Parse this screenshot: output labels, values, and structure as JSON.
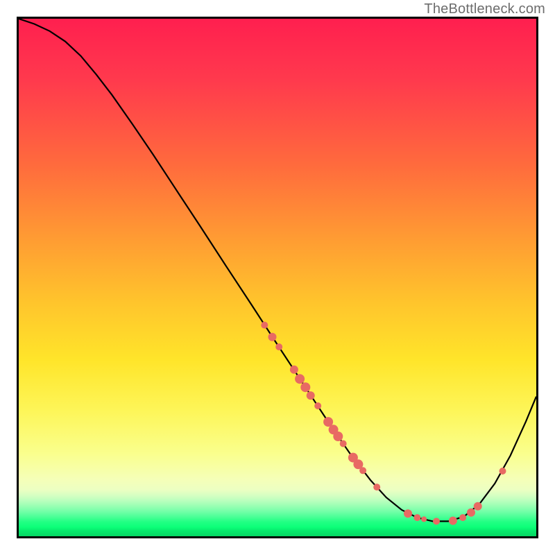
{
  "attribution": "TheBottleneck.com",
  "colors": {
    "curve": "#000000",
    "point": "#e86a63",
    "border": "#000000"
  },
  "chart_data": {
    "type": "line",
    "title": "",
    "xlabel": "",
    "ylabel": "",
    "xlim": [
      0,
      100
    ],
    "ylim": [
      0,
      100
    ],
    "curve": [
      {
        "x": 0,
        "y": 100
      },
      {
        "x": 3,
        "y": 99
      },
      {
        "x": 6,
        "y": 97.6
      },
      {
        "x": 9,
        "y": 95.6
      },
      {
        "x": 12,
        "y": 92.8
      },
      {
        "x": 15,
        "y": 89.2
      },
      {
        "x": 18,
        "y": 85.3
      },
      {
        "x": 22,
        "y": 79.6
      },
      {
        "x": 26,
        "y": 73.7
      },
      {
        "x": 30,
        "y": 67.6
      },
      {
        "x": 35,
        "y": 60.0
      },
      {
        "x": 40,
        "y": 52.3
      },
      {
        "x": 45,
        "y": 44.7
      },
      {
        "x": 50,
        "y": 37.0
      },
      {
        "x": 55,
        "y": 29.4
      },
      {
        "x": 60,
        "y": 21.8
      },
      {
        "x": 64,
        "y": 16.0
      },
      {
        "x": 68,
        "y": 10.8
      },
      {
        "x": 71,
        "y": 7.5
      },
      {
        "x": 74,
        "y": 5.1
      },
      {
        "x": 77,
        "y": 3.6
      },
      {
        "x": 80,
        "y": 2.9
      },
      {
        "x": 83,
        "y": 2.9
      },
      {
        "x": 86,
        "y": 3.8
      },
      {
        "x": 89,
        "y": 6.2
      },
      {
        "x": 92,
        "y": 10.2
      },
      {
        "x": 95,
        "y": 15.6
      },
      {
        "x": 98,
        "y": 22.2
      },
      {
        "x": 100,
        "y": 27.0
      }
    ],
    "points": [
      {
        "x": 47.5,
        "y": 40.8,
        "r": 5
      },
      {
        "x": 49.0,
        "y": 38.5,
        "r": 6
      },
      {
        "x": 50.3,
        "y": 36.6,
        "r": 5
      },
      {
        "x": 53.2,
        "y": 32.2,
        "r": 6
      },
      {
        "x": 54.3,
        "y": 30.4,
        "r": 7
      },
      {
        "x": 55.4,
        "y": 28.8,
        "r": 7
      },
      {
        "x": 56.4,
        "y": 27.2,
        "r": 6
      },
      {
        "x": 57.8,
        "y": 25.2,
        "r": 5
      },
      {
        "x": 59.8,
        "y": 22.1,
        "r": 7
      },
      {
        "x": 60.8,
        "y": 20.6,
        "r": 7
      },
      {
        "x": 61.7,
        "y": 19.3,
        "r": 7
      },
      {
        "x": 62.7,
        "y": 17.9,
        "r": 5
      },
      {
        "x": 64.6,
        "y": 15.2,
        "r": 7
      },
      {
        "x": 65.6,
        "y": 13.9,
        "r": 7
      },
      {
        "x": 66.5,
        "y": 12.7,
        "r": 5
      },
      {
        "x": 69.2,
        "y": 9.5,
        "r": 5
      },
      {
        "x": 75.2,
        "y": 4.4,
        "r": 6
      },
      {
        "x": 77.0,
        "y": 3.6,
        "r": 5
      },
      {
        "x": 78.3,
        "y": 3.3,
        "r": 4
      },
      {
        "x": 80.7,
        "y": 2.9,
        "r": 5
      },
      {
        "x": 83.9,
        "y": 3.0,
        "r": 6
      },
      {
        "x": 85.8,
        "y": 3.6,
        "r": 5
      },
      {
        "x": 87.4,
        "y": 4.6,
        "r": 6
      },
      {
        "x": 88.7,
        "y": 5.8,
        "r": 6
      },
      {
        "x": 93.5,
        "y": 12.6,
        "r": 5
      }
    ]
  }
}
